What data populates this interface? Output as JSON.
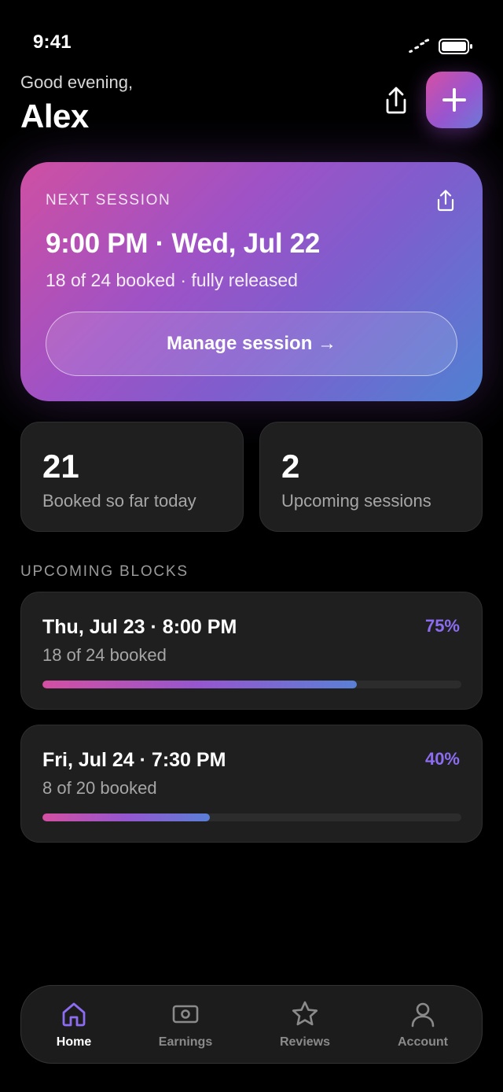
{
  "status_bar": {
    "time": "9:41"
  },
  "header": {
    "greeting": "Good evening,",
    "name": "Alex"
  },
  "next_session": {
    "label": "NEXT SESSION",
    "time": "9:00 PM · Wed, Jul 22",
    "meta": "18 of 24 booked · fully released",
    "button_label": "Manage session →"
  },
  "stats": [
    {
      "value": "21",
      "label": "Booked so far today"
    },
    {
      "value": "2",
      "label": "Upcoming sessions"
    }
  ],
  "upcoming": {
    "title": "UPCOMING BLOCKS",
    "blocks": [
      {
        "title": "Thu, Jul 23 · 8:00 PM",
        "sub": "18 of 24 booked",
        "percent_label": "75%",
        "progress": 0.75
      },
      {
        "title": "Fri, Jul 24 · 7:30 PM",
        "sub": "8 of 20 booked",
        "percent_label": "40%",
        "progress": 0.4
      }
    ]
  },
  "tabs": [
    {
      "label": "Home",
      "icon": "home-icon",
      "active": true
    },
    {
      "label": "Earnings",
      "icon": "cash-icon",
      "active": false
    },
    {
      "label": "Reviews",
      "icon": "star-icon",
      "active": false
    },
    {
      "label": "Account",
      "icon": "person-icon",
      "active": false
    }
  ],
  "colors": {
    "accent": "#8c6cf0",
    "gradient_start": "#d44fa2",
    "gradient_end": "#5a7fd6"
  }
}
